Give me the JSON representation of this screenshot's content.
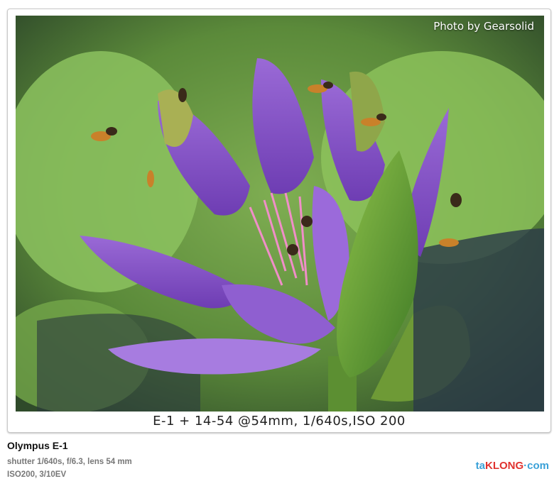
{
  "photo": {
    "credit": "Photo by Gearsolid",
    "caption": "E-1 + 14-54 @54mm, 1/640s,ISO 200"
  },
  "info": {
    "camera": "Olympus E-1",
    "line1": "shutter 1/640s,  f/6.3,  lens 54 mm",
    "line2": "ISO200,  3/10EV"
  },
  "logo": {
    "part1": "ta",
    "part2": "KLONG",
    "part3": "·com"
  }
}
